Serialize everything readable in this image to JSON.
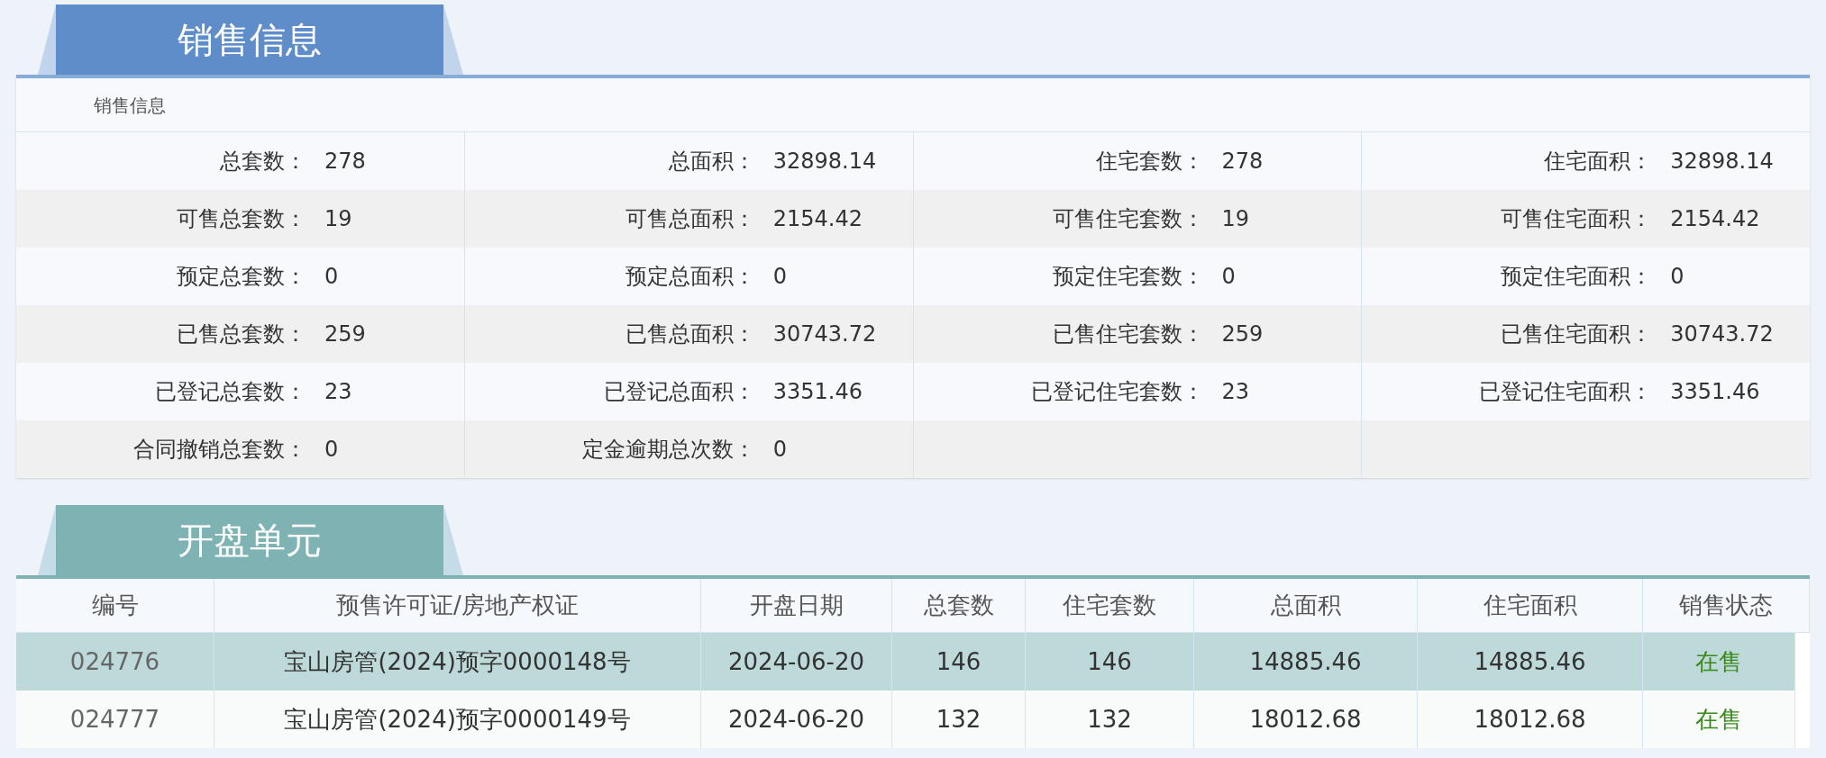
{
  "sales_tab": {
    "title": "销售信息"
  },
  "sales_panel": {
    "caption": "销售信息",
    "rows": [
      [
        {
          "label": "总套数：",
          "value": "278"
        },
        {
          "label": "总面积：",
          "value": "32898.14"
        },
        {
          "label": "住宅套数：",
          "value": "278"
        },
        {
          "label": "住宅面积：",
          "value": "32898.14"
        }
      ],
      [
        {
          "label": "可售总套数：",
          "value": "19"
        },
        {
          "label": "可售总面积：",
          "value": "2154.42"
        },
        {
          "label": "可售住宅套数：",
          "value": "19"
        },
        {
          "label": "可售住宅面积：",
          "value": "2154.42"
        }
      ],
      [
        {
          "label": "预定总套数：",
          "value": "0"
        },
        {
          "label": "预定总面积：",
          "value": "0"
        },
        {
          "label": "预定住宅套数：",
          "value": "0"
        },
        {
          "label": "预定住宅面积：",
          "value": "0"
        }
      ],
      [
        {
          "label": "已售总套数：",
          "value": "259"
        },
        {
          "label": "已售总面积：",
          "value": "30743.72"
        },
        {
          "label": "已售住宅套数：",
          "value": "259"
        },
        {
          "label": "已售住宅面积：",
          "value": "30743.72"
        }
      ],
      [
        {
          "label": "已登记总套数：",
          "value": "23"
        },
        {
          "label": "已登记总面积：",
          "value": "3351.46"
        },
        {
          "label": "已登记住宅套数：",
          "value": "23"
        },
        {
          "label": "已登记住宅面积：",
          "value": "3351.46"
        }
      ],
      [
        {
          "label": "合同撤销总套数：",
          "value": "0"
        },
        {
          "label": "定金逾期总次数：",
          "value": "0"
        }
      ]
    ]
  },
  "units_tab": {
    "title": "开盘单元"
  },
  "units_table": {
    "columns": [
      "编号",
      "预售许可证/房地产权证",
      "开盘日期",
      "总套数",
      "住宅套数",
      "总面积",
      "住宅面积",
      "销售状态"
    ],
    "rows": [
      {
        "selected": true,
        "cells": [
          "024776",
          "宝山房管(2024)预字0000148号",
          "2024-06-20",
          "146",
          "146",
          "14885.46",
          "14885.46",
          "在售"
        ]
      },
      {
        "selected": false,
        "cells": [
          "024777",
          "宝山房管(2024)预字0000149号",
          "2024-06-20",
          "132",
          "132",
          "18012.68",
          "18012.68",
          "在售"
        ]
      }
    ]
  }
}
